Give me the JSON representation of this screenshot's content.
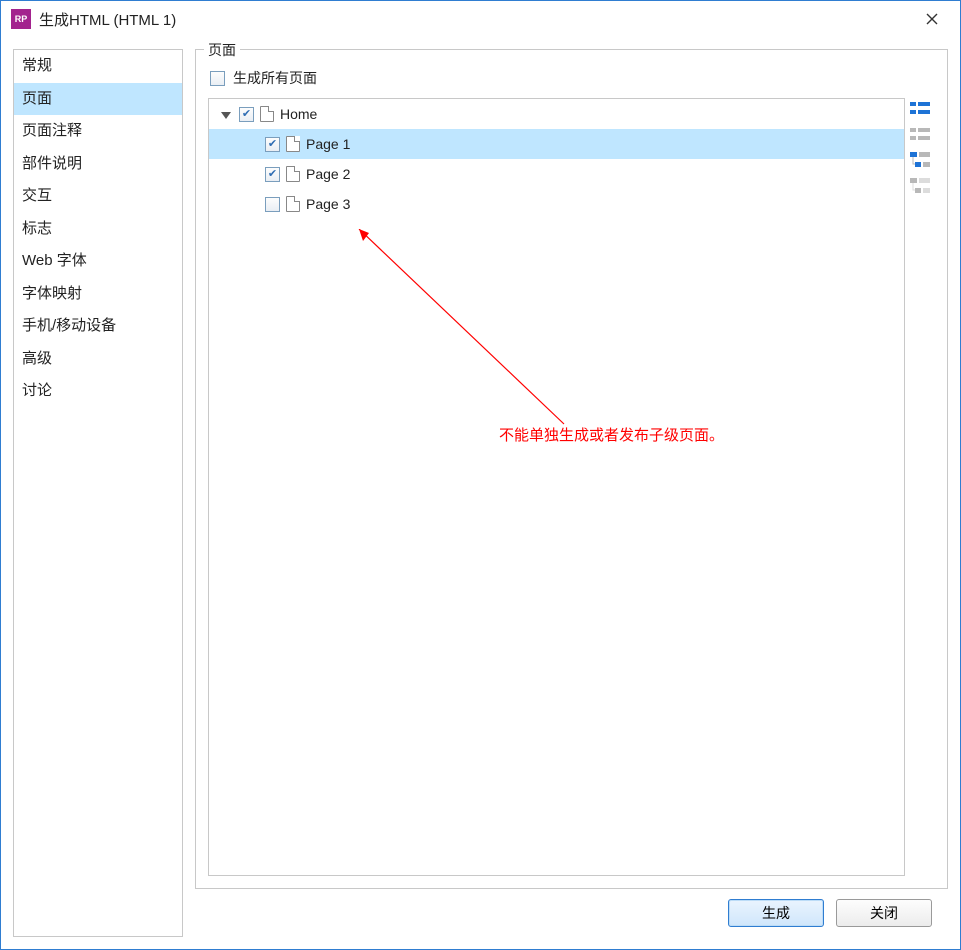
{
  "window": {
    "title": "生成HTML (HTML 1)"
  },
  "sidebar": {
    "items": [
      {
        "label": "常规"
      },
      {
        "label": "页面"
      },
      {
        "label": "页面注释"
      },
      {
        "label": "部件说明"
      },
      {
        "label": "交互"
      },
      {
        "label": "标志"
      },
      {
        "label": "Web 字体"
      },
      {
        "label": "字体映射"
      },
      {
        "label": "手机/移动设备"
      },
      {
        "label": "高级"
      },
      {
        "label": "讨论"
      }
    ],
    "selected_index": 1
  },
  "main": {
    "group_label": "页面",
    "generate_all_label": "生成所有页面",
    "generate_all_checked": false,
    "tree": [
      {
        "label": "Home",
        "depth": 0,
        "checked": true,
        "expanded": true,
        "selected": false
      },
      {
        "label": "Page 1",
        "depth": 1,
        "checked": true,
        "selected": true
      },
      {
        "label": "Page 2",
        "depth": 1,
        "checked": true,
        "selected": false
      },
      {
        "label": "Page 3",
        "depth": 1,
        "checked": false,
        "selected": false
      }
    ],
    "side_icons": [
      {
        "name": "select-all-icon",
        "color": "#1e73d6"
      },
      {
        "name": "select-none-icon",
        "color": "#9a9a9a"
      },
      {
        "name": "select-children-icon",
        "color": "#1e73d6"
      },
      {
        "name": "deselect-children-icon",
        "color": "#9a9a9a"
      }
    ],
    "annotation_text": "不能单独生成或者发布子级页面。"
  },
  "footer": {
    "generate_label": "生成",
    "close_label": "关闭"
  }
}
